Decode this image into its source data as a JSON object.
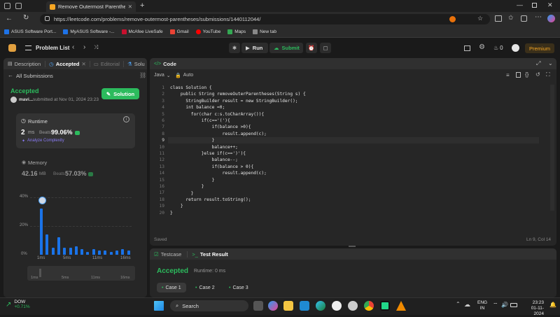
{
  "browser": {
    "tab_title": "Remove Outermost Parentheses",
    "url": "https://leetcode.com/problems/remove-outermost-parentheses/submissions/1440112044/",
    "bookmarks": [
      {
        "label": "ASUS Software Port...",
        "color": "#1e73e8"
      },
      {
        "label": "MyASUS Software -...",
        "color": "#1e73e8"
      },
      {
        "label": "McAfee LiveSafe",
        "color": "#c8102e"
      },
      {
        "label": "Gmail",
        "color": "#ea4335"
      },
      {
        "label": "YouTube",
        "color": "#ff0000"
      },
      {
        "label": "Maps",
        "color": "#34a853"
      },
      {
        "label": "New tab",
        "color": "#888888"
      }
    ]
  },
  "lcnav": {
    "problem_list": "Problem List",
    "run": "Run",
    "submit": "Submit",
    "streak": "0",
    "premium": "Premium"
  },
  "left": {
    "tabs": {
      "description": "Description",
      "accepted": "Accepted",
      "editorial": "Editorial",
      "solutions": "Solu"
    },
    "all_submissions": "All Submissions",
    "status": "Accepted",
    "user": "mavi...",
    "submitted": "submitted at Nov 01, 2024 23:23",
    "solution_btn": "Solution",
    "runtime_label": "Runtime",
    "runtime_value": "2",
    "runtime_unit": "ms",
    "beats_label": "Beats",
    "runtime_beats": "99.06%",
    "analyze": "Analyze Complexity",
    "memory_label": "Memory",
    "memory_value": "42.16",
    "memory_unit": "MB",
    "memory_beats": "57.03%"
  },
  "chart_data": {
    "type": "bar",
    "y_ticks": [
      "40%",
      "20%",
      "0%"
    ],
    "x_ticks": [
      "1ms",
      "5ms",
      "11ms",
      "16ms"
    ],
    "ylim": [
      0,
      40
    ],
    "values": [
      32,
      14,
      5,
      12,
      5,
      5,
      6,
      4,
      2,
      4,
      3,
      3,
      2,
      3,
      4,
      3
    ]
  },
  "editor": {
    "title": "Code",
    "language": "Java",
    "mode": "Auto",
    "status": "Saved",
    "cursor": "Ln 9, Col 14",
    "lines": [
      "class Solution {",
      "    public String removeOuterParentheses(String s) {",
      "      StringBuilder result = new StringBuilder();",
      "      int balance =0;",
      "        for(char c:s.toCharArray()){",
      "            if(c=='('){",
      "                if(balance >0){",
      "                    result.append(c);",
      "                }",
      "                balance++;",
      "            }else if(c==')'){",
      "                balance--;",
      "                if(balance > 0){",
      "                    result.append(c);",
      "                }",
      "            }",
      "        }",
      "      return result.toString();",
      "    }",
      "}"
    ]
  },
  "bottom": {
    "testcase_tab": "Testcase",
    "result_tab": "Test Result",
    "status": "Accepted",
    "runtime": "Runtime: 0 ms",
    "cases": [
      "Case 1",
      "Case 2",
      "Case 3"
    ]
  },
  "taskbar": {
    "ticker": "DOW",
    "change": "+0.71%",
    "search": "Search",
    "lang1": "ENG",
    "lang2": "IN",
    "time": "23:23",
    "date": "01-11-2024"
  }
}
